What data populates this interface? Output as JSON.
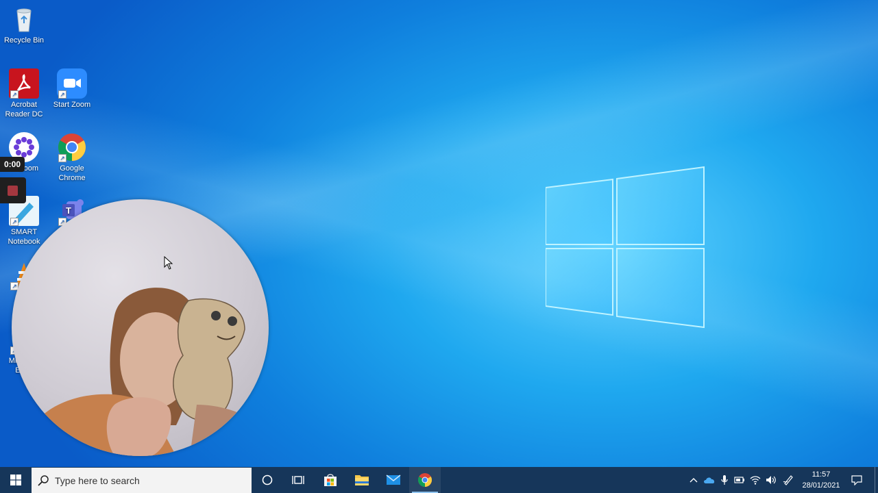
{
  "desktop": {
    "icons": [
      {
        "label": "Recycle Bin",
        "icon": "recycle-bin-icon"
      },
      {
        "label": "Acrobat Reader DC",
        "icon": "acrobat-icon"
      },
      {
        "label": "Start Zoom",
        "icon": "zoom-icon"
      },
      {
        "label": "Zoom",
        "icon": "zoom-app-icon"
      },
      {
        "label": "Google Chrome",
        "icon": "chrome-icon"
      },
      {
        "label": "SMART Notebook",
        "icon": "smart-notebook-icon"
      },
      {
        "label": "Teams",
        "icon": "teams-icon"
      },
      {
        "label": "VLC",
        "icon": "vlc-icon"
      },
      {
        "label": "Microsoft Edge",
        "icon": "edge-icon"
      }
    ]
  },
  "recorder": {
    "elapsed": "0:00",
    "stop_color": "#a4373f"
  },
  "taskbar": {
    "search_placeholder": "Type here to search",
    "pinned": [
      "cortana-icon",
      "task-view-icon",
      "store-icon",
      "file-explorer-icon",
      "mail-icon",
      "chrome-icon"
    ],
    "tray": [
      "show-hidden-icons",
      "onedrive-icon",
      "microphone-icon",
      "battery-icon",
      "wifi-icon",
      "volume-icon",
      "pen-icon"
    ],
    "time": "11:57",
    "date": "28/01/2021",
    "background": "#16365a"
  }
}
